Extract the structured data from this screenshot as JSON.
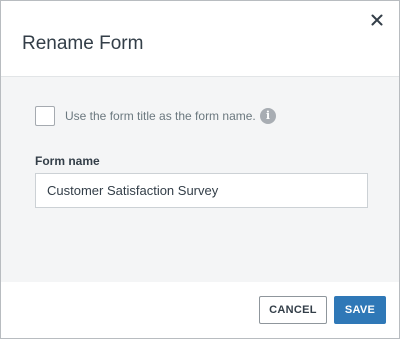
{
  "dialog": {
    "title": "Rename Form",
    "close_icon": "close-icon"
  },
  "options": {
    "use_title_checkbox_checked": false,
    "use_title_label": "Use the form title as the form name.",
    "info_icon": "info-icon",
    "info_glyph": "i"
  },
  "form_name": {
    "label": "Form name",
    "value": "Customer Satisfaction Survey"
  },
  "footer": {
    "cancel_label": "CANCEL",
    "save_label": "SAVE"
  },
  "colors": {
    "primary": "#2f78b7",
    "body_background": "#f4f5f6",
    "text_dark": "#333e48",
    "text_muted": "#6b787f"
  }
}
